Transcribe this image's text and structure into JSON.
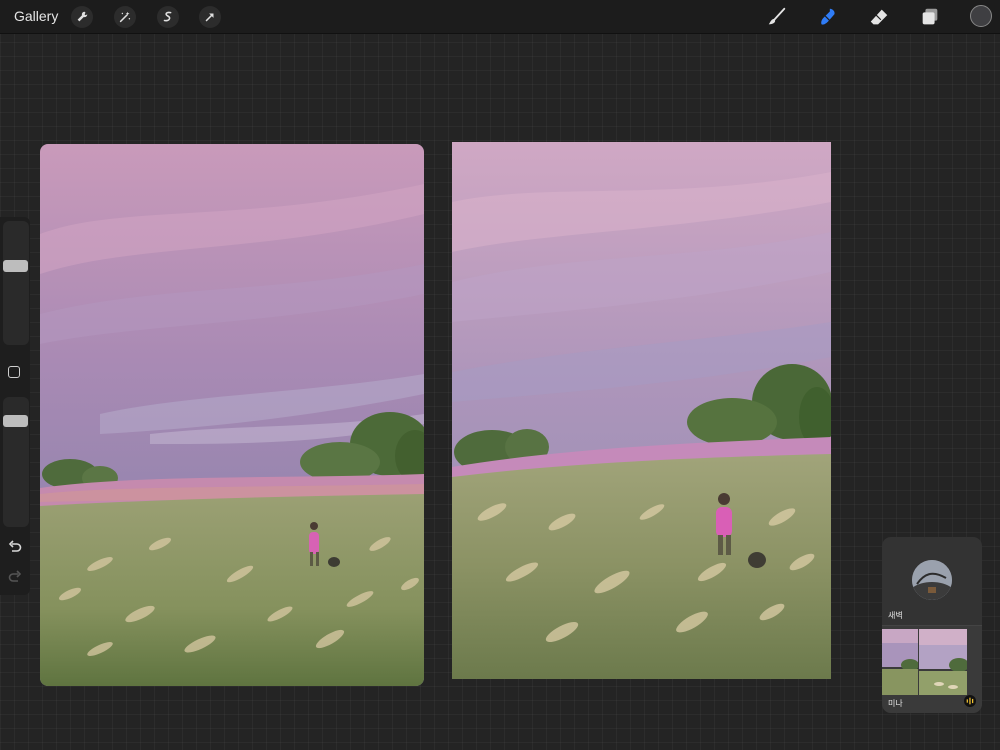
{
  "topbar": {
    "gallery_label": "Gallery",
    "left_tools": [
      {
        "icon": "wrench-icon",
        "name": "actions"
      },
      {
        "icon": "magic-wand-icon",
        "name": "adjustments"
      },
      {
        "icon": "selection-icon",
        "name": "selection"
      },
      {
        "icon": "arrow-cursor-icon",
        "name": "transform"
      }
    ],
    "right_tools": [
      {
        "icon": "brush-icon",
        "name": "paint"
      },
      {
        "icon": "smudge-icon",
        "name": "smudge",
        "active": true
      },
      {
        "icon": "eraser-icon",
        "name": "erase"
      },
      {
        "icon": "layers-icon",
        "name": "layers"
      }
    ],
    "current_color": "#3f3f42",
    "active_tool_color": "#2f7cf6"
  },
  "sidebar": {
    "brush_size_level": 0.65,
    "opacity_level": 0.85,
    "undo_icon": "undo-icon",
    "redo_icon": "redo-icon"
  },
  "reference_panel": {
    "top_label": "새벽",
    "bottom_label": "미나",
    "audio_icon": "audio-waveform-icon"
  },
  "colors": {
    "canvas_bg": "#242424",
    "topbar_bg": "#1c1c1c",
    "sky_pink": "#c796b6",
    "sky_lavender": "#8f86ab",
    "field_green": "#7d8a5c",
    "flower_pink": "#c98bb4"
  }
}
